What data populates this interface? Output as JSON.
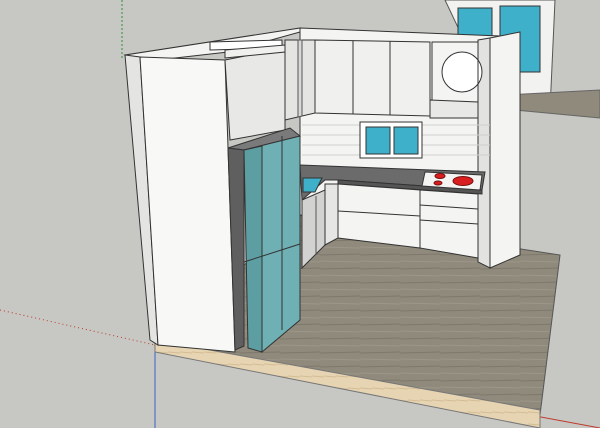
{
  "viewport": {
    "background": "#c7c7c3",
    "axes": {
      "red": "#c0392b",
      "green": "#2f8f3a",
      "blue": "#3d5fc4"
    }
  },
  "scene": {
    "floor": "wood-laminate",
    "appliances": [
      "refrigerator",
      "sink",
      "cooktop",
      "range-hood",
      "wall-clock"
    ],
    "colors": {
      "wall": "#f4f4f2",
      "cabinet": "#ececea",
      "fridge": "#6fb0b4",
      "glass": "#3fb0c9",
      "burner": "#d81e1e",
      "countertop": "#6b6b6b"
    }
  }
}
